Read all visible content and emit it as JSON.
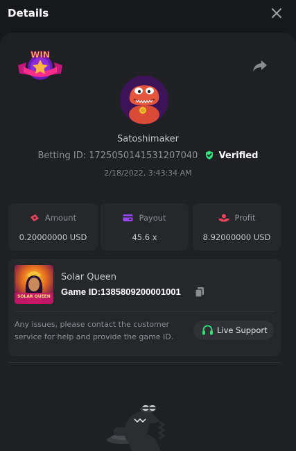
{
  "header": {
    "title": "Details"
  },
  "bet": {
    "username": "Satoshimaker",
    "betting_id_label": "Betting ID:",
    "betting_id": "1725050141531207040",
    "verified_label": "Verified",
    "date": "2/18/2022, 3:43:34 AM",
    "badge_text": "WIN"
  },
  "stats": [
    {
      "label": "Amount",
      "value": "0.20000000 USD",
      "icon": "money-icon"
    },
    {
      "label": "Payout",
      "value": "45.6 x",
      "icon": "wallet-icon"
    },
    {
      "label": "Profit",
      "value": "8.92000000 USD",
      "icon": "profit-icon"
    }
  ],
  "game": {
    "name": "Solar Queen",
    "id_label": "Game ID:",
    "id": "1385809200001001",
    "thumb_text": "SOLAR QUEEN",
    "issue_text": "Any issues, please contact the customer service for help and provide the game ID.",
    "support_label": "Live Support"
  },
  "colors": {
    "accent_green": "#2fe07b",
    "accent_red": "#f0455c",
    "accent_purple": "#9a46ff",
    "card_bg": "#1f2023",
    "panel_bg": "#26272b"
  }
}
